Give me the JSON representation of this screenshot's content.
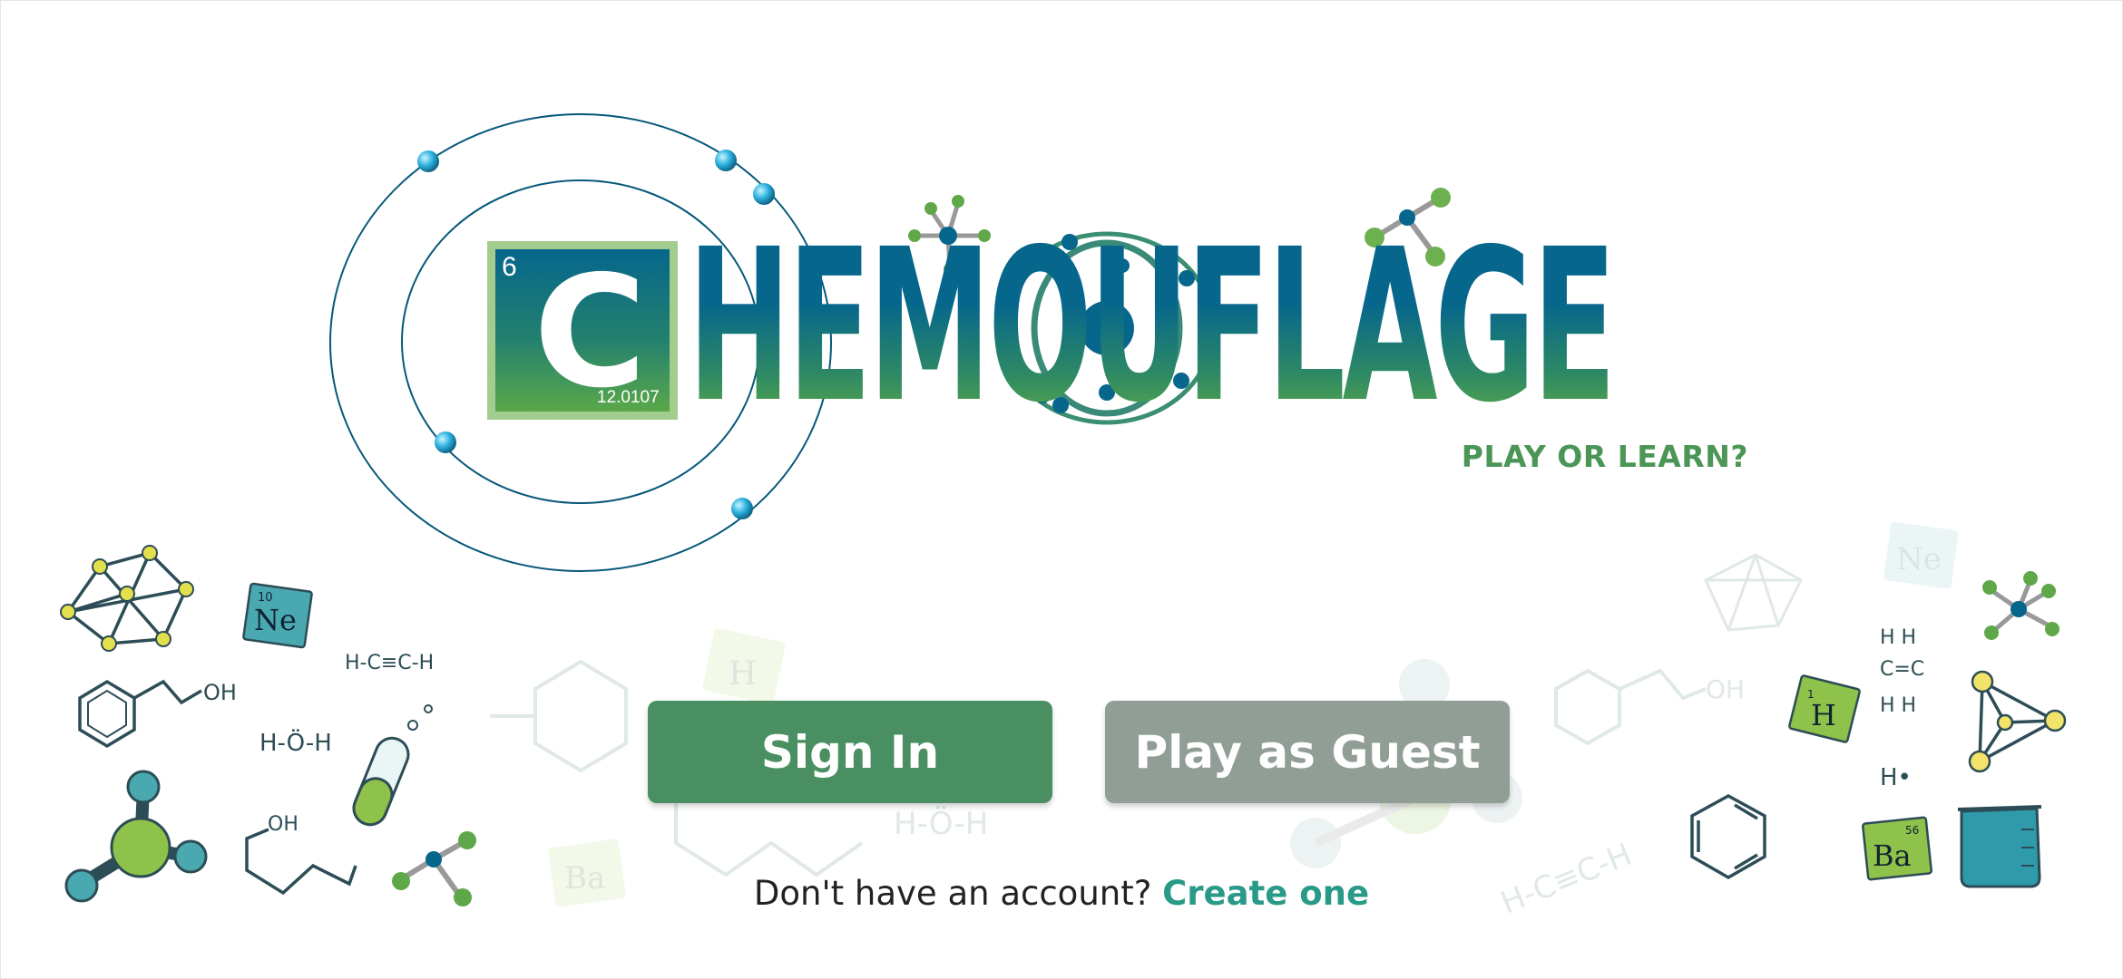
{
  "logo": {
    "element_number": "6",
    "element_symbol": "C",
    "atomic_mass": "12.0107",
    "title_rest": "HEMOUFLAGE",
    "tagline": "PLAY OR LEARN?"
  },
  "doodles": {
    "neon_symbol": "Ne",
    "neon_number": "10",
    "hydrogen_symbol": "H",
    "hydrogen_number": "1",
    "barium_symbol": "Ba",
    "barium_number": "56",
    "ethanol_label": "OH",
    "alcohol_label": "OH",
    "acetylene_formula": "H-C≡C-H",
    "water_formula": "H-Ö-H",
    "hydrogen_radical": "H•",
    "ethylene_top": "H    H",
    "ethylene_mid": "C=C",
    "ethylene_bottom": "H    H"
  },
  "actions": {
    "sign_in_label": "Sign In",
    "guest_label": "Play as Guest"
  },
  "account": {
    "prompt": "Don't have an account?",
    "link_label": "Create one"
  },
  "colors": {
    "primary_blue": "#06668c",
    "primary_green": "#4a8f62",
    "guest_gray": "#919e96",
    "link_teal": "#2a9a88",
    "tagline_green": "#4b9656"
  }
}
